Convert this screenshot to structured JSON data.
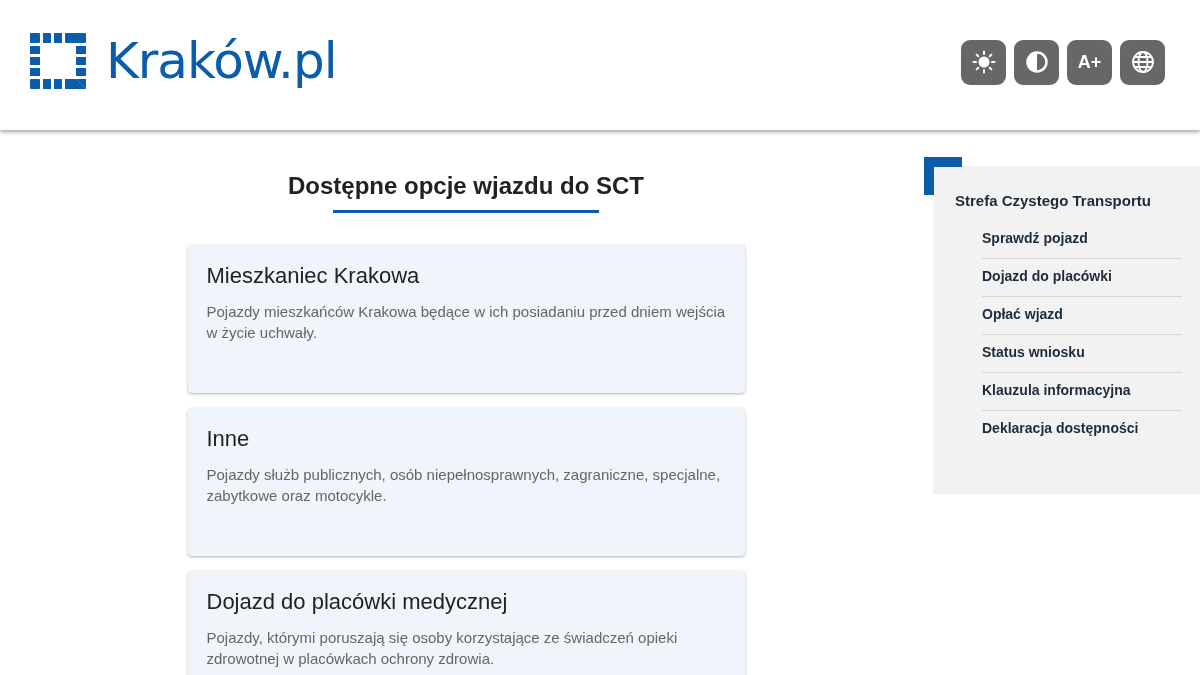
{
  "header": {
    "logo_text": "Kraków.pl",
    "tools": [
      {
        "kind": "brightness"
      },
      {
        "kind": "contrast"
      },
      {
        "kind": "text",
        "label": "A+"
      },
      {
        "kind": "language"
      }
    ]
  },
  "main": {
    "heading": "Dostępne opcje wjazdu do SCT",
    "cards": [
      {
        "title": "Mieszkaniec Krakowa",
        "description": "Pojazdy mieszkańców Krakowa będące w ich posiadaniu przed dniem wejścia w życie uchwały."
      },
      {
        "title": "Inne",
        "description": "Pojazdy służb publicznych, osób niepełnosprawnych, zagraniczne, specjalne, zabytkowe oraz motocykle."
      },
      {
        "title": "Dojazd do placówki medycznej",
        "description": "Pojazdy, którymi poruszają się osoby korzystające ze świadczeń opieki zdrowotnej w placówkach ochrony zdrowia."
      }
    ]
  },
  "sidebar": {
    "title": "Strefa Czystego Transportu",
    "items": [
      "Sprawdź pojazd",
      "Dojazd do placówki",
      "Opłać wjazd",
      "Status wniosku",
      "Klauzula informacyjna",
      "Deklaracja dostępności"
    ]
  }
}
